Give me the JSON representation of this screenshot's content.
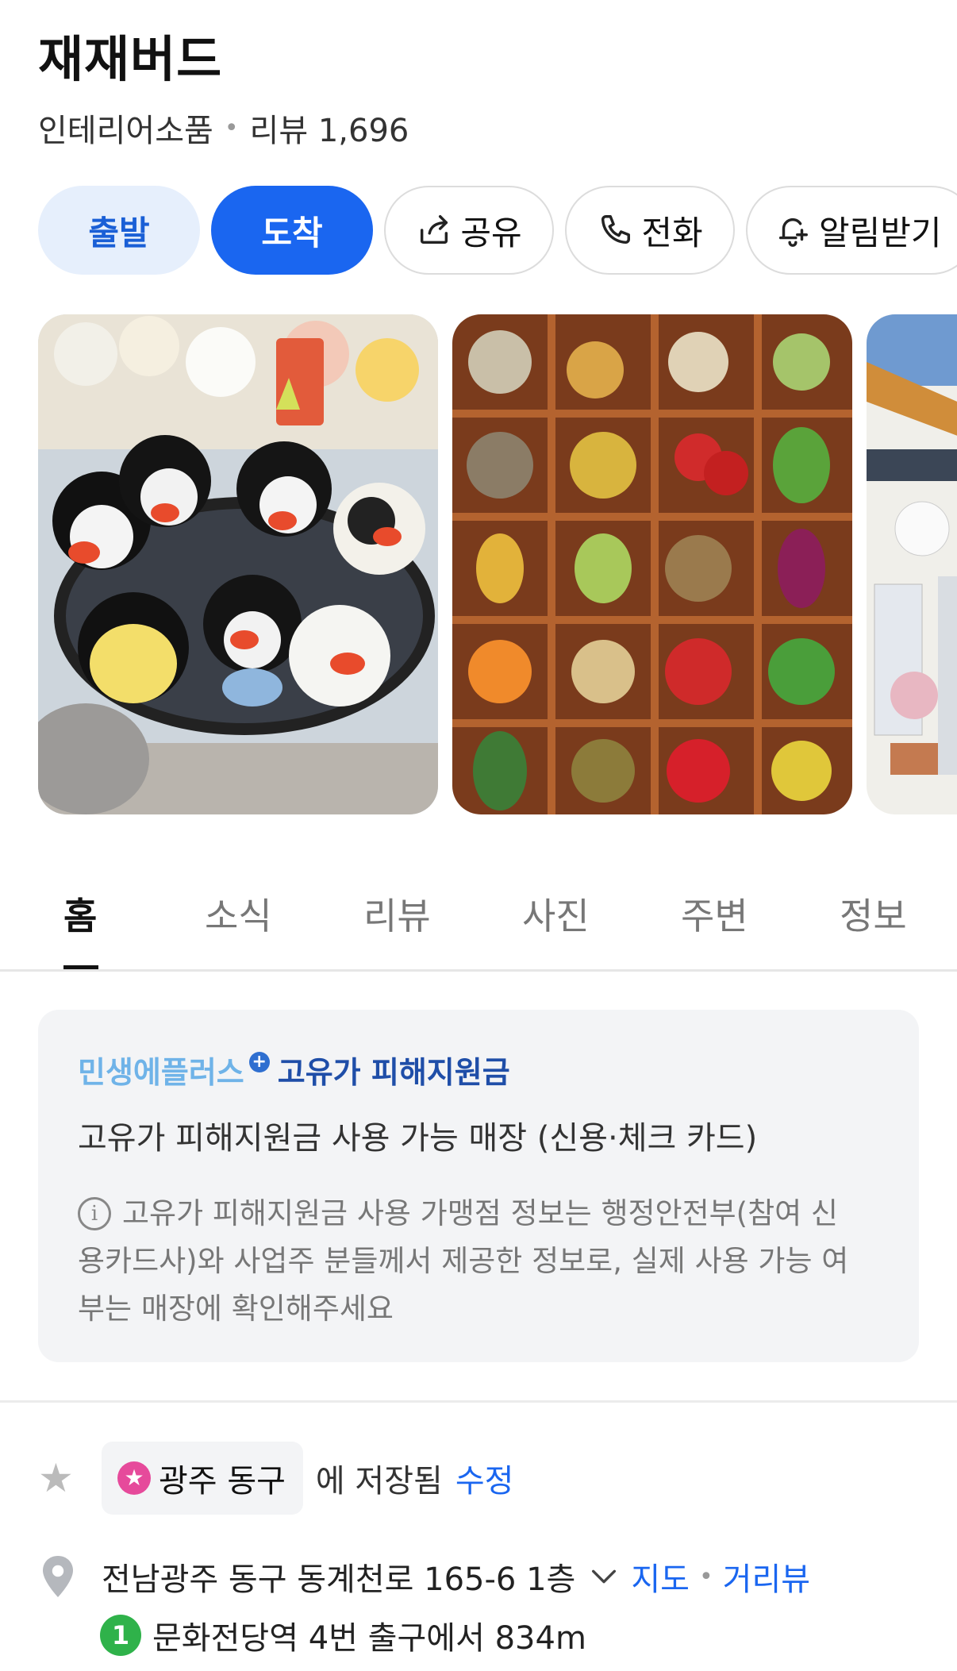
{
  "place": {
    "name": "재재버드",
    "category": "인테리어소품",
    "separator": "•",
    "review_count": "리뷰 1,696"
  },
  "actions": {
    "start": "출발",
    "arrive": "도착",
    "share": "공유",
    "call": "전화",
    "notify": "알림받기"
  },
  "photos": [
    {
      "icon": "plush-penguins-photo"
    },
    {
      "icon": "felt-vegetables-photo"
    },
    {
      "icon": "storefront-photo"
    }
  ],
  "tabs": [
    {
      "label": "홈",
      "active": true
    },
    {
      "label": "소식",
      "active": false
    },
    {
      "label": "리뷰",
      "active": false
    },
    {
      "label": "사진",
      "active": false
    },
    {
      "label": "주변",
      "active": false
    },
    {
      "label": "정보",
      "active": false
    }
  ],
  "notice": {
    "brand_part1": "민생에플러스",
    "brand_plus": "+",
    "brand_part2": "고유가 피해지원금",
    "headline": "고유가 피해지원금 사용 가능 매장 (신용·체크 카드)",
    "info_line1": "고유가 피해지원금 사용 가맹점 정보는 행정안전부(참여 신",
    "info_line2": "용카드사)와 사업주 분들께서 제공한 정보로, 실제 사용 가능 여",
    "info_line3": "부는 매장에 확인해주세요"
  },
  "saved": {
    "list_name": "광주 동구",
    "suffix": "에 저장됨",
    "edit": "수정"
  },
  "address": {
    "text": "전남광주 동구 동계천로 165-6 1층",
    "map_link": "지도",
    "separator": "•",
    "street_view_link": "거리뷰"
  },
  "transit": {
    "line_number": "1",
    "line_color": "#2fb24a",
    "text": "문화전당역 4번 출구에서 834m"
  },
  "colors": {
    "accent": "#1a66f0",
    "start_bg": "#e6effc"
  }
}
